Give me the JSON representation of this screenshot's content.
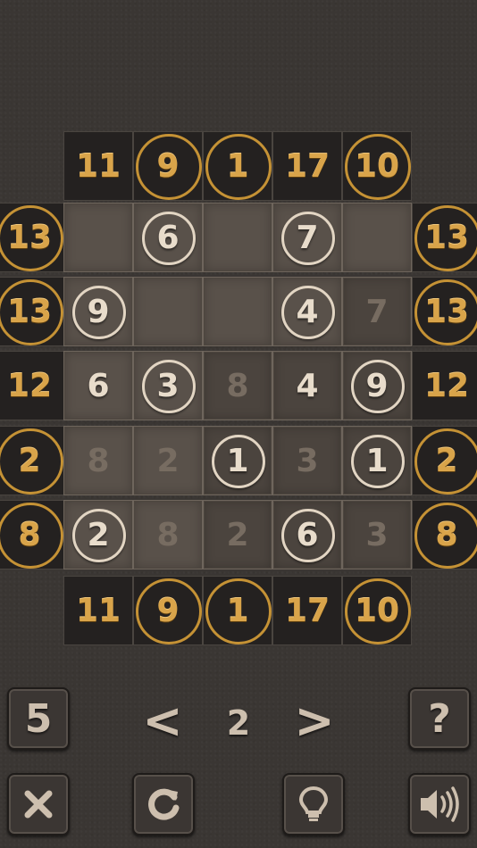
{
  "puzzle": {
    "top_clues": [
      {
        "value": "11",
        "circled": false
      },
      {
        "value": "9",
        "circled": true
      },
      {
        "value": "1",
        "circled": true
      },
      {
        "value": "17",
        "circled": false
      },
      {
        "value": "10",
        "circled": true
      }
    ],
    "bottom_clues": [
      {
        "value": "11",
        "circled": false
      },
      {
        "value": "9",
        "circled": true
      },
      {
        "value": "1",
        "circled": true
      },
      {
        "value": "17",
        "circled": false
      },
      {
        "value": "10",
        "circled": true
      }
    ],
    "left_clues": [
      {
        "value": "13",
        "circled": true
      },
      {
        "value": "13",
        "circled": true
      },
      {
        "value": "12",
        "circled": false
      },
      {
        "value": "2",
        "circled": true
      },
      {
        "value": "8",
        "circled": true
      }
    ],
    "right_clues": [
      {
        "value": "13",
        "circled": true
      },
      {
        "value": "13",
        "circled": true
      },
      {
        "value": "12",
        "circled": false
      },
      {
        "value": "2",
        "circled": true
      },
      {
        "value": "8",
        "circled": true
      }
    ],
    "grid": [
      [
        {
          "v": "",
          "s": "empty"
        },
        {
          "v": "6",
          "s": "circled"
        },
        {
          "v": "",
          "s": "empty"
        },
        {
          "v": "7",
          "s": "circled"
        },
        {
          "v": "",
          "s": "empty"
        }
      ],
      [
        {
          "v": "9",
          "s": "circled"
        },
        {
          "v": "",
          "s": "empty"
        },
        {
          "v": "",
          "s": "empty"
        },
        {
          "v": "4",
          "s": "circled"
        },
        {
          "v": "7",
          "s": "faded"
        }
      ],
      [
        {
          "v": "6",
          "s": "bright"
        },
        {
          "v": "3",
          "s": "circled"
        },
        {
          "v": "8",
          "s": "faded"
        },
        {
          "v": "4",
          "s": "bright"
        },
        {
          "v": "9",
          "s": "circled"
        }
      ],
      [
        {
          "v": "8",
          "s": "faded"
        },
        {
          "v": "2",
          "s": "faded"
        },
        {
          "v": "1",
          "s": "circled"
        },
        {
          "v": "3",
          "s": "faded"
        },
        {
          "v": "1",
          "s": "circled"
        }
      ],
      [
        {
          "v": "2",
          "s": "circled"
        },
        {
          "v": "8",
          "s": "faded"
        },
        {
          "v": "2",
          "s": "faded"
        },
        {
          "v": "6",
          "s": "circled"
        },
        {
          "v": "3",
          "s": "faded"
        }
      ]
    ]
  },
  "controls": {
    "size_label": "5",
    "prev_label": "<",
    "page_number": "2",
    "next_label": ">",
    "help_label": "?",
    "close_icon": "close-icon",
    "restart_icon": "restart-icon",
    "hint_icon": "lightbulb-icon",
    "sound_icon": "speaker-icon"
  },
  "colors": {
    "background": "#3a3633",
    "clue_gold": "#d9a44a",
    "ring_gold": "#c59235",
    "cell_fill": "#59514a",
    "number_light": "#e8dccb"
  }
}
